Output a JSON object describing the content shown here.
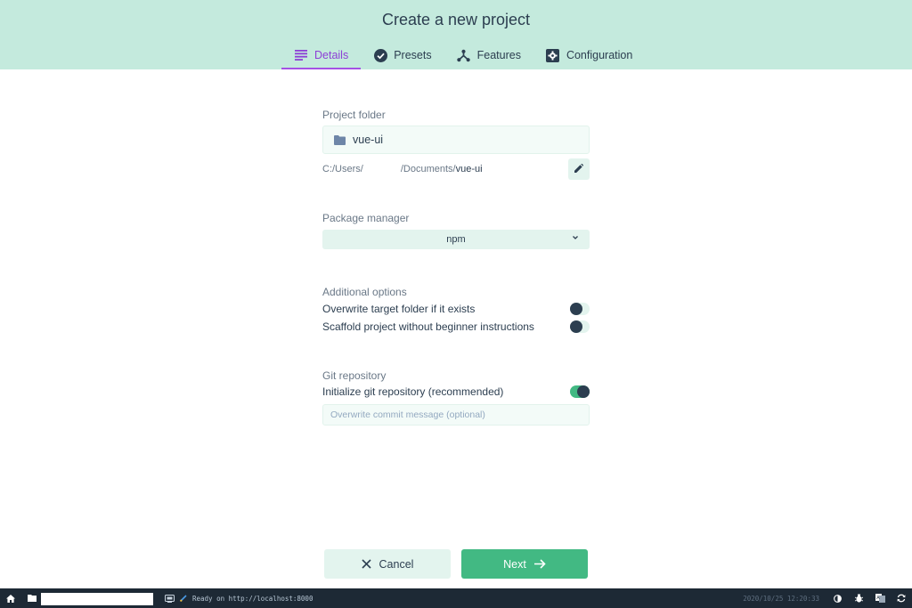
{
  "header": {
    "title": "Create a new project",
    "tabs": [
      {
        "label": "Details",
        "icon": "list-icon",
        "active": true
      },
      {
        "label": "Presets",
        "icon": "check-circle-icon",
        "active": false
      },
      {
        "label": "Features",
        "icon": "fork-icon",
        "active": false
      },
      {
        "label": "Configuration",
        "icon": "settings-box-icon",
        "active": false
      }
    ]
  },
  "project_folder": {
    "label": "Project folder",
    "value": "vue-ui",
    "path_prefix": "C:/Users/",
    "path_middle": "/Documents/",
    "path_name": "vue-ui"
  },
  "package_manager": {
    "label": "Package manager",
    "selected": "npm"
  },
  "additional_options": {
    "label": "Additional options",
    "options": [
      {
        "label": "Overwrite target folder if it exists",
        "enabled": false
      },
      {
        "label": "Scaffold project without beginner instructions",
        "enabled": false
      }
    ]
  },
  "git": {
    "label": "Git repository",
    "init_label": "Initialize git repository (recommended)",
    "init_enabled": true,
    "commit_placeholder": "Overwrite commit message (optional)",
    "commit_value": ""
  },
  "actions": {
    "cancel_label": "Cancel",
    "next_label": "Next"
  },
  "statusbar": {
    "status_text": "Ready on http://localhost:8000",
    "datetime": "2020/10/25 12:20:33"
  },
  "colors": {
    "accent": "#42b983",
    "header_bg": "#c4eadd",
    "active_tab": "#a451e4",
    "statusbar_bg": "#1d2935"
  }
}
